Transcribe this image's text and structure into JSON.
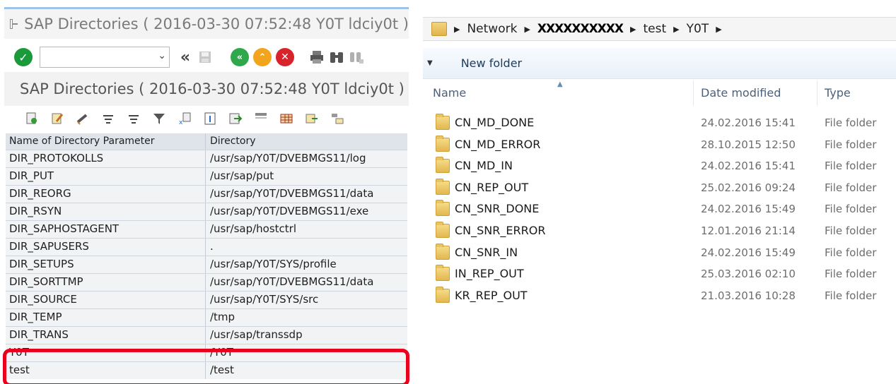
{
  "sap": {
    "window_title": "SAP Directories ( 2016-03-30 07:52:48 Y0T ldciy0t )",
    "screen_title": "SAP Directories ( 2016-03-30 07:52:48 Y0T ldciy0t )",
    "command_field_value": "",
    "table": {
      "headers": [
        "Name of Directory Parameter",
        "Directory"
      ],
      "rows": [
        [
          "DIR_PROTOKOLLS",
          "/usr/sap/Y0T/DVEBMGS11/log"
        ],
        [
          "DIR_PUT",
          "/usr/sap/put"
        ],
        [
          "DIR_REORG",
          "/usr/sap/Y0T/DVEBMGS11/data"
        ],
        [
          "DIR_RSYN",
          "/usr/sap/Y0T/DVEBMGS11/exe"
        ],
        [
          "DIR_SAPHOSTAGENT",
          "/usr/sap/hostctrl"
        ],
        [
          "DIR_SAPUSERS",
          "."
        ],
        [
          "DIR_SETUPS",
          "/usr/sap/Y0T/SYS/profile"
        ],
        [
          "DIR_SORTTMP",
          "/usr/sap/Y0T/DVEBMGS11/data"
        ],
        [
          "DIR_SOURCE",
          "/usr/sap/Y0T/SYS/src"
        ],
        [
          "DIR_TEMP",
          "/tmp"
        ],
        [
          "DIR_TRANS",
          "/usr/sap/transsdp"
        ],
        [
          "Y0T",
          "/Y0T"
        ],
        [
          "test",
          "/test"
        ]
      ]
    },
    "highlight_color": "#e8001c"
  },
  "explorer": {
    "breadcrumb": [
      "Network",
      "XXXXXXXXXX",
      "test",
      "Y0T"
    ],
    "toolbar": {
      "new_folder": "New folder"
    },
    "columns": {
      "name": "Name",
      "date": "Date modified",
      "type": "Type"
    },
    "folders": [
      {
        "name": "CN_MD_DONE",
        "date": "24.02.2016 15:41",
        "type": "File folder"
      },
      {
        "name": "CN_MD_ERROR",
        "date": "28.10.2015 12:50",
        "type": "File folder"
      },
      {
        "name": "CN_MD_IN",
        "date": "24.02.2016 15:41",
        "type": "File folder"
      },
      {
        "name": "CN_REP_OUT",
        "date": "25.02.2016 09:24",
        "type": "File folder"
      },
      {
        "name": "CN_SNR_DONE",
        "date": "24.02.2016 15:49",
        "type": "File folder"
      },
      {
        "name": "CN_SNR_ERROR",
        "date": "12.01.2016 21:14",
        "type": "File folder"
      },
      {
        "name": "CN_SNR_IN",
        "date": "24.02.2016 15:49",
        "type": "File folder"
      },
      {
        "name": "IN_REP_OUT",
        "date": "25.03.2016 02:10",
        "type": "File folder"
      },
      {
        "name": "KR_REP_OUT",
        "date": "21.03.2016 10:28",
        "type": "File folder"
      }
    ]
  },
  "icons": {
    "enter": "check-icon",
    "back": "back-arrows-icon",
    "save": "save-icon",
    "nav_back": "green-back-icon",
    "nav_up": "yellow-up-icon",
    "cancel": "red-cancel-icon",
    "print": "print-icon",
    "find": "binoculars-icon"
  }
}
